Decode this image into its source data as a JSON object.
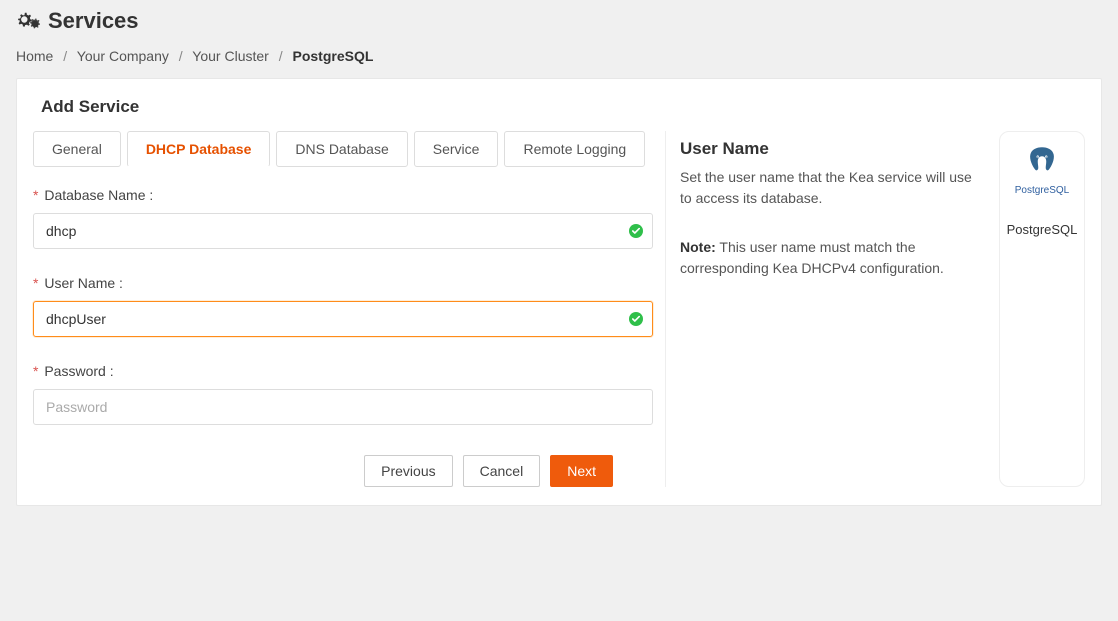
{
  "page": {
    "title": "Services"
  },
  "breadcrumb": {
    "home": "Home",
    "company": "Your Company",
    "cluster": "Your Cluster",
    "current": "PostgreSQL"
  },
  "panel": {
    "heading": "Add Service"
  },
  "tabs": {
    "general": "General",
    "dhcp_db": "DHCP Database",
    "dns_db": "DNS Database",
    "service": "Service",
    "remote_logging": "Remote Logging",
    "active": "dhcp_db"
  },
  "form": {
    "database_name": {
      "label": "Database Name",
      "value": "dhcp",
      "required": true,
      "valid": true
    },
    "user_name": {
      "label": "User Name",
      "value": "dhcpUser",
      "required": true,
      "valid": true,
      "focused": true
    },
    "password": {
      "label": "Password",
      "value": "",
      "placeholder": "Password",
      "required": true
    }
  },
  "buttons": {
    "previous": "Previous",
    "cancel": "Cancel",
    "next": "Next"
  },
  "help": {
    "title": "User Name",
    "description": "Set the user name that the Kea service will use to access its database.",
    "note_label": "Note:",
    "note_text": "This user name must match the corresponding Kea DHCPv4 configuration."
  },
  "service_card": {
    "logo_text": "PostgreSQL",
    "caption": "PostgreSQL"
  },
  "colors": {
    "accent": "#ef5b0c",
    "success": "#2fbf4a"
  }
}
